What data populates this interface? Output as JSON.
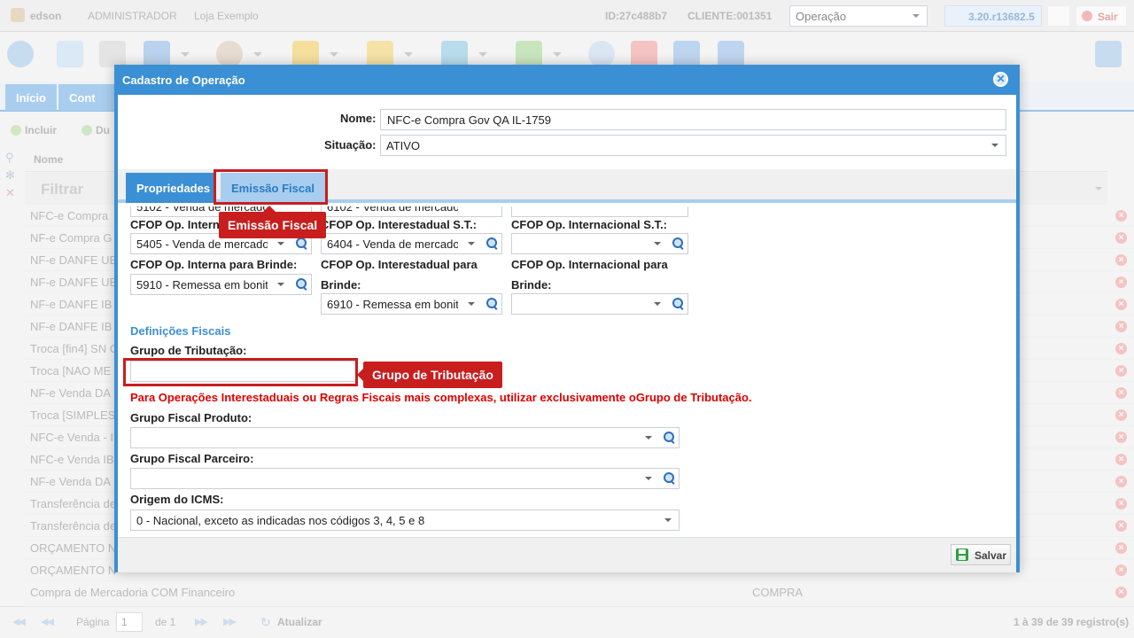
{
  "header": {
    "user": "edson",
    "role": "ADMINISTRADOR",
    "store": "Loja Exemplo",
    "id": "ID:27c488b7",
    "client": "CLIENTE:001351",
    "operation_select": "Operação",
    "version": "3.20.r13682.5",
    "logout_label": "Sair"
  },
  "tabs": {
    "inicio": "Início",
    "cont": "Cont"
  },
  "actions": {
    "incluir": "Incluir",
    "duplicar": "Du"
  },
  "grid": {
    "col_nome": "Nome",
    "filter_label": "Filtrar",
    "rows": [
      {
        "name": "NFC-e Compra",
        "type": ""
      },
      {
        "name": "NF-e Compra G",
        "type": ""
      },
      {
        "name": "NF-e DANFE UE",
        "type": ""
      },
      {
        "name": "NF-e DANFE UE",
        "type": ""
      },
      {
        "name": "NF-e DANFE IB",
        "type": ""
      },
      {
        "name": "NF-e DANFE IB",
        "type": ""
      },
      {
        "name": "Troca [fin4] SN C",
        "type": ""
      },
      {
        "name": "Troca [NAO ME",
        "type": ""
      },
      {
        "name": "NF-e Venda DA",
        "type": ""
      },
      {
        "name": "Troca [SIMPLES",
        "type": ""
      },
      {
        "name": "NFC-e Venda - I",
        "type": ""
      },
      {
        "name": "NFC-e Venda IB",
        "type": ""
      },
      {
        "name": "NF-e Venda DA",
        "type": ""
      },
      {
        "name": "Transferência de",
        "type": ""
      },
      {
        "name": "Transferência de",
        "type": ""
      },
      {
        "name": "ORÇAMENTO N",
        "type": ""
      },
      {
        "name": "ORÇAMENTO N",
        "type": ""
      },
      {
        "name": "Compra de Mercadoria COM Financeiro",
        "type": "COMPRA"
      }
    ]
  },
  "pager": {
    "page_label": "Página",
    "page_value": "1",
    "of_label": "de 1",
    "refresh_label": "Atualizar",
    "records": "1 à 39 de 39 registro(s)"
  },
  "modal": {
    "title": "Cadastro de Operação",
    "close_symbol": "✕",
    "nome_label": "Nome:",
    "nome_value": "NFC-e Compra Gov QA IL-1759",
    "situacao_label": "Situação:",
    "situacao_value": "ATIVO",
    "tab_propriedades": "Propriedades",
    "tab_emissao": "Emissão Fiscal",
    "top_partial_1": "5102 - Venda de mercado",
    "top_partial_2": "6102 - Venda de mercado",
    "cfop_interna_st_label": "CFOP Op. Interna S.T.:",
    "cfop_interestadual_st_label": "CFOP Op. Interestadual S.T.:",
    "cfop_internacional_st_label": "CFOP Op. Internacional S.T.:",
    "cfop_interna_st_value": "5405 - Venda de mercado",
    "cfop_interestadual_st_value": "6404 - Venda de mercado",
    "cfop_interna_brinde_label": "CFOP Op. Interna para Brinde:",
    "cfop_interestadual_brinde_label_1": "CFOP Op. Interestadual para",
    "cfop_interestadual_brinde_label_2": "Brinde:",
    "cfop_internacional_brinde_label_1": "CFOP Op. Internacional para",
    "cfop_internacional_brinde_label_2": "Brinde:",
    "cfop_interna_brinde_value": "5910 - Remessa em bonit",
    "cfop_interestadual_brinde_value": "6910 - Remessa em bonit",
    "definicoes_title": "Definições Fiscais",
    "grupo_tributacao_label": "Grupo de Tributação:",
    "grupo_tributacao_value": "",
    "warning": "Para Operações Interestaduais ou Regras Fiscais mais complexas, utilizar exclusivamente oGrupo de Tributação.",
    "grupo_fiscal_produto_label": "Grupo Fiscal Produto:",
    "grupo_fiscal_parceiro_label": "Grupo Fiscal Parceiro:",
    "origem_icms_label": "Origem do ICMS:",
    "origem_icms_value": "0 - Nacional, exceto as indicadas nos códigos 3, 4, 5 e 8",
    "save_label": "Salvar"
  },
  "annotations": {
    "emissao_callout": "Emissão Fiscal",
    "grupo_callout": "Grupo de Tributação",
    "color": "#c81e1e"
  },
  "colors": {
    "accent": "#3b8fd4",
    "warning": "#e00000"
  }
}
